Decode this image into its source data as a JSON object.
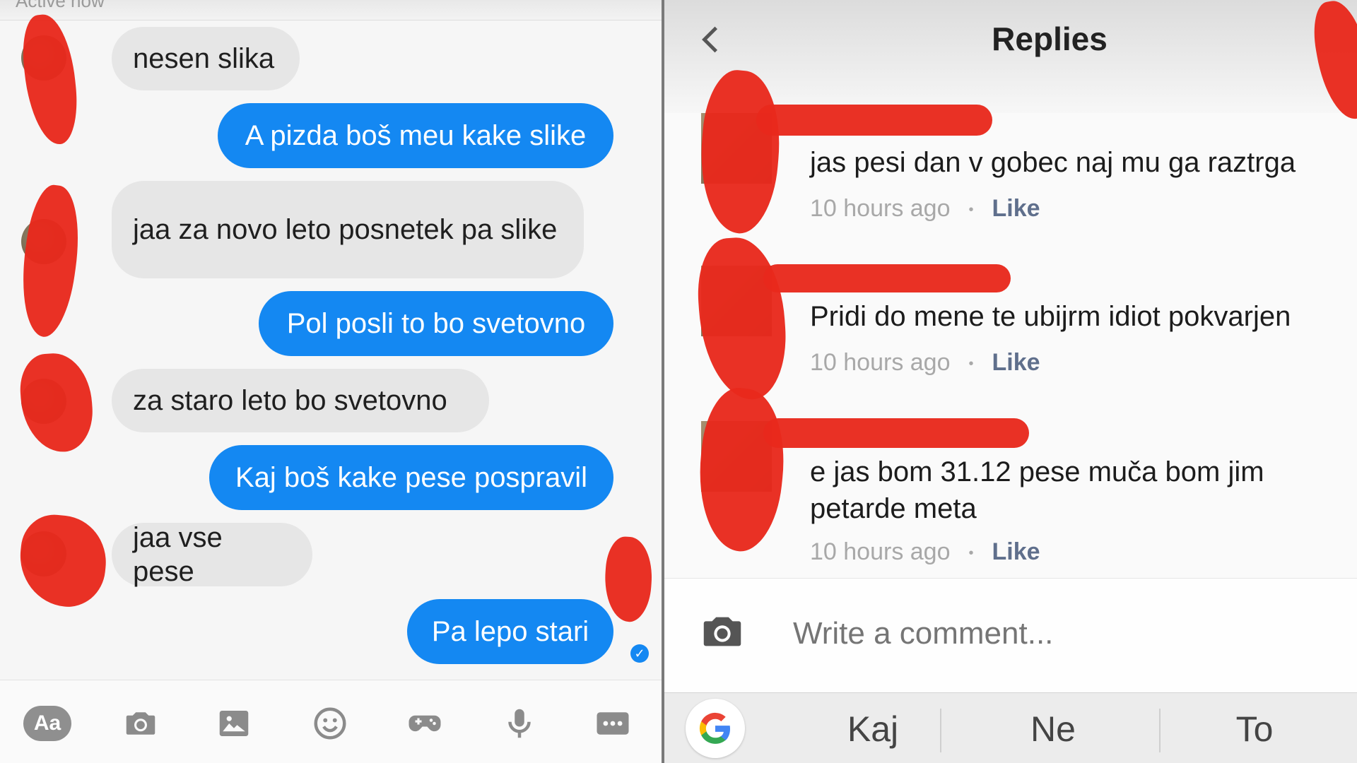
{
  "chat": {
    "top_status": "Active now",
    "messages": [
      {
        "side": "in",
        "text": "nesen slika"
      },
      {
        "side": "out",
        "text": "A pizda boš meu kake slike"
      },
      {
        "side": "in",
        "text": "jaa za novo leto posnetek pa slike"
      },
      {
        "side": "out",
        "text": "Pol posli to bo svetovno"
      },
      {
        "side": "in",
        "text": "za staro leto bo  svetovno"
      },
      {
        "side": "out",
        "text": "Kaj boš kake pese pospravil"
      },
      {
        "side": "in",
        "text": "jaa vse pese"
      },
      {
        "side": "out",
        "text": "Pa lepo stari"
      }
    ],
    "toolbar": {
      "aa_label": "Aa",
      "icons": [
        "camera-icon",
        "image-icon",
        "emoji-icon",
        "game-icon",
        "microphone-icon",
        "more-icon"
      ]
    }
  },
  "replies": {
    "title": "Replies",
    "items": [
      {
        "text": "jas pesi dan v gobec naj mu ga raztrga",
        "time": "10 hours ago",
        "like": "Like"
      },
      {
        "text": "Pridi do mene te ubijrm idiot pokvarjen",
        "time": "10 hours ago",
        "like": "Like"
      },
      {
        "text": "e jas bom 31.12 pese muča bom jim petarde meta",
        "time": "10 hours ago",
        "like": "Like"
      }
    ],
    "compose_placeholder": "Write a comment...",
    "keyboard_suggestions": [
      "Kaj",
      "Ne",
      "To"
    ]
  },
  "colors": {
    "outgoing_bubble": "#1488f2",
    "incoming_bubble": "#e6e6e6",
    "redaction": "#e8291c",
    "like_link": "#5f6f8c"
  }
}
